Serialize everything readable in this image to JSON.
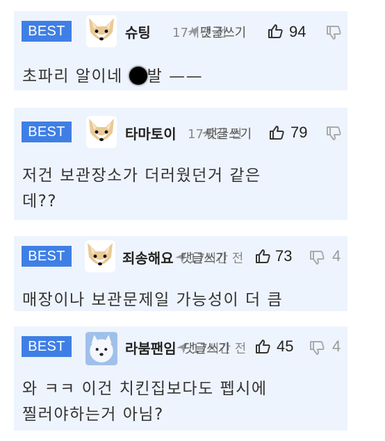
{
  "comments": [
    {
      "badge": "BEST",
      "nickname": "슈팅",
      "meta": "17시간 전",
      "reply_label": "댓글쓰기",
      "likes": "94",
      "dislikes": "",
      "text_before": "초파리 알이네 ",
      "text_after": "발 ——",
      "avatar": "fox-avatar"
    },
    {
      "badge": "BEST",
      "nickname": "타마토이",
      "meta": "17시간 전",
      "reply_label": "댓글쓰기",
      "likes": "79",
      "dislikes": "",
      "text": "저건 보관장소가 더러웠던거 같은\n데??",
      "avatar": "fox-avatar"
    },
    {
      "badge": "BEST",
      "nickname": "죄송해요",
      "meta": "17시간 전",
      "reply_label": "댓글쓰기",
      "likes": "73",
      "dislikes": "4",
      "text": "매장이나 보관문제일 가능성이 더 큼",
      "avatar": "fox-avatar"
    },
    {
      "badge": "BEST",
      "nickname": "라붐팬임",
      "meta": "17시간 전",
      "reply_label": "댓글쓰기",
      "likes": "45",
      "dislikes": "4",
      "text": "와 ㅋㅋ 이건 치킨집보다도 펩시에\n찔러야하는거 아님?",
      "avatar": "white-dog-avatar"
    }
  ],
  "colors": {
    "badge": "#3f7fe5",
    "card": "#eef4fd"
  }
}
